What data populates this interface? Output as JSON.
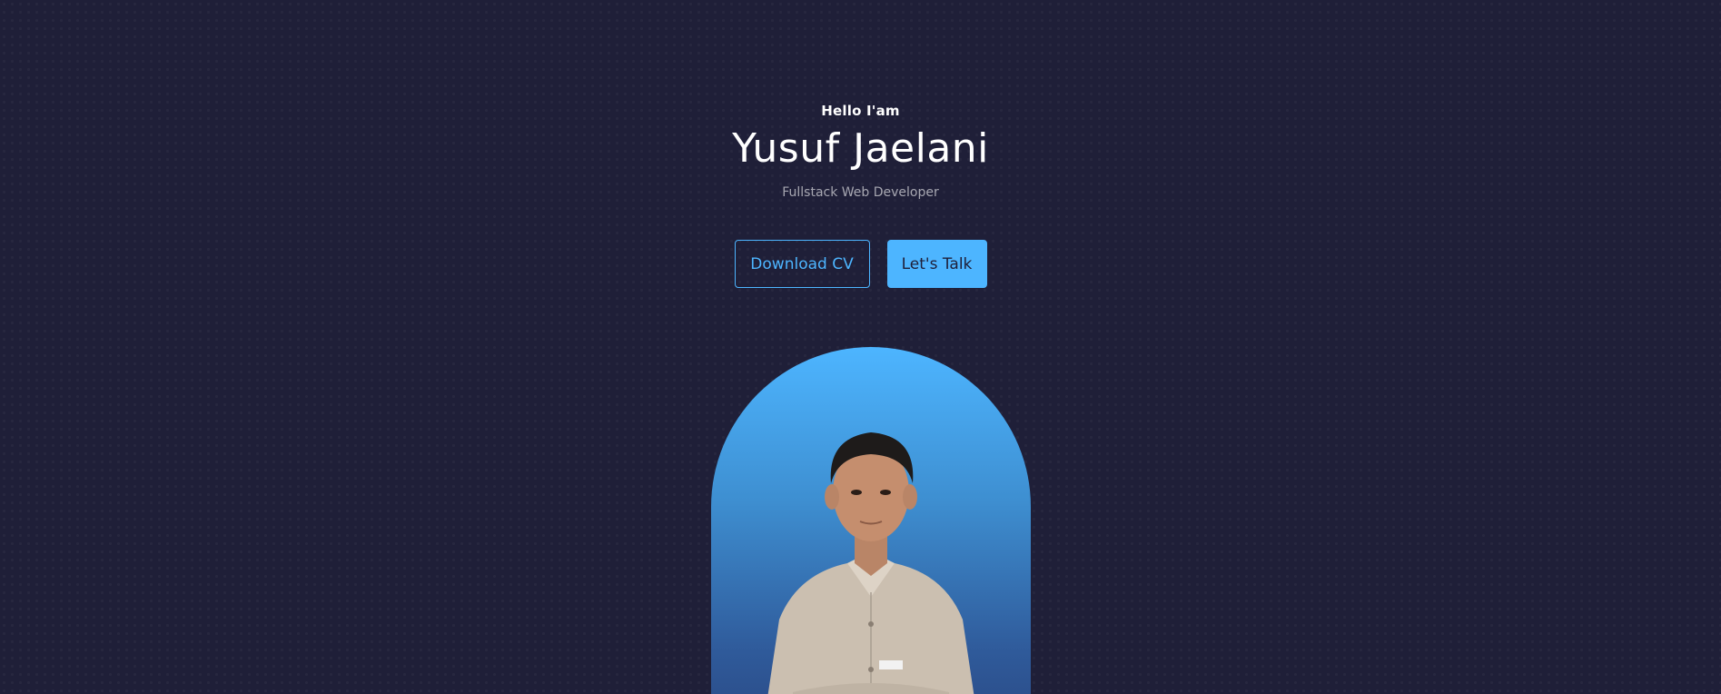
{
  "hero": {
    "greeting": "Hello I'am",
    "name": "Yusuf Jaelani",
    "role": "Fullstack Web Developer",
    "buttons": {
      "download_cv": "Download CV",
      "lets_talk": "Let's Talk"
    },
    "portrait": {
      "icon": "person-portrait",
      "gradient_colors": [
        "#4db5ff",
        "#2a4a85"
      ]
    }
  },
  "colors": {
    "background": "#1f1f38",
    "accent": "#4db5ff",
    "text": "#ffffff",
    "muted_text": "#a7a7b5"
  }
}
